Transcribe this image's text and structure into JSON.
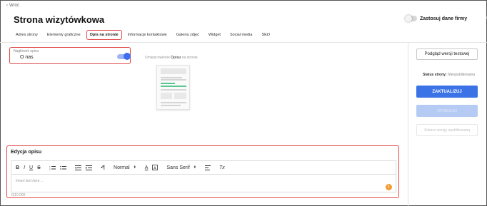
{
  "header": {
    "back_label": "Wróć",
    "title": "Strona wizytówkowa",
    "company_data_label": "Zastosuj dane firmy"
  },
  "tabs": [
    {
      "label": "Adres strony"
    },
    {
      "label": "Elementy graficzne"
    },
    {
      "label": "Opis na stronie",
      "active": true
    },
    {
      "label": "Informacje kontaktowe"
    },
    {
      "label": "Galeria zdjęć"
    },
    {
      "label": "Widget"
    },
    {
      "label": "Social media"
    },
    {
      "label": "SEO"
    }
  ],
  "heading_field": {
    "label": "Nagłówek opisu",
    "value": "O nas",
    "toggle_on": true
  },
  "placement": {
    "prefix": "Umiejscowienie",
    "bold": "Opisu",
    "suffix": "na stronie"
  },
  "editor": {
    "title": "Edycja opisu",
    "toolbar": {
      "bold": "B",
      "italic": "I",
      "underline": "U",
      "strike": "S",
      "paragraph": "¶",
      "format_select": "Normal",
      "font_color": "A",
      "font_select": "Sans Serif",
      "clear_format": "Tx"
    },
    "placeholder": "Insert text here ...",
    "counter": "0/10 000",
    "help_icon": "!"
  },
  "sidebar": {
    "preview_button": "Podgląd wersji testowej",
    "status_label": "Status strony:",
    "status_value": "Nieopublikowana",
    "update_button": "ZAKTUALIZUJ",
    "publish_button": "OPUBLIKUJ",
    "published_preview_button": "Zobacz wersję opublikowaną"
  },
  "colors": {
    "accent_blue": "#3b73e6",
    "highlight_red": "#e04848",
    "help_orange": "#f39b32"
  }
}
